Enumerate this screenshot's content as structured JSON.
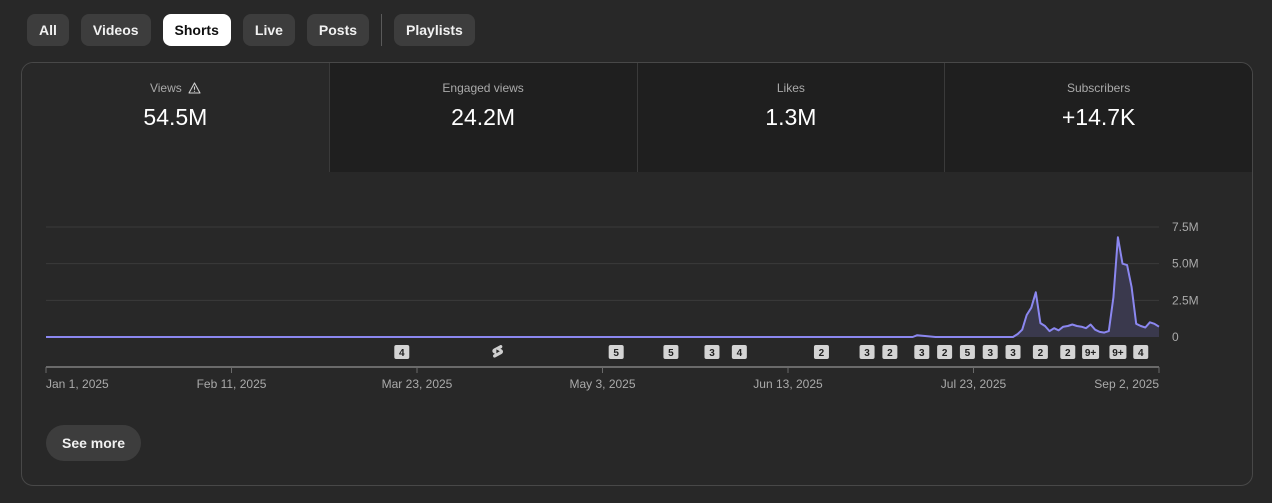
{
  "tabs": [
    {
      "label": "All",
      "active": false
    },
    {
      "label": "Videos",
      "active": false
    },
    {
      "label": "Shorts",
      "active": true
    },
    {
      "label": "Live",
      "active": false
    },
    {
      "label": "Posts",
      "active": false
    },
    {
      "label": "Playlists",
      "active": false
    }
  ],
  "metrics": [
    {
      "label": "Views",
      "value": "54.5M",
      "icon": "warning-icon",
      "active": true
    },
    {
      "label": "Engaged views",
      "value": "24.2M",
      "active": false
    },
    {
      "label": "Likes",
      "value": "1.3M",
      "active": false
    },
    {
      "label": "Subscribers",
      "value": "+14.7K",
      "active": false
    }
  ],
  "see_more_label": "See more",
  "colors": {
    "line": "#8b87f0",
    "fill": "#3a394d",
    "grid": "#3a3a3a",
    "text": "#aaaaaa"
  },
  "chart_data": {
    "type": "area",
    "x_tick_labels": [
      "Jan 1, 2025",
      "Feb 11, 2025",
      "Mar 23, 2025",
      "May 3, 2025",
      "Jun 13, 2025",
      "Jul 23, 2025",
      "Sep 2, 2025"
    ],
    "y_tick_labels": [
      "0",
      "2.5M",
      "5.0M",
      "7.5M"
    ],
    "ylim": [
      0,
      7500000
    ],
    "x_range_days": [
      0,
      244
    ],
    "series": [
      {
        "x": [
          0,
          190,
          191,
          195,
          202,
          212,
          213,
          214,
          215,
          216,
          217,
          218,
          219,
          220,
          221,
          222,
          223,
          224,
          225,
          226,
          227,
          228,
          229,
          230,
          231,
          232,
          233,
          234,
          235,
          236,
          237,
          238,
          239,
          240,
          241,
          242,
          243,
          244
        ],
        "values": [
          0,
          0,
          120000,
          0,
          0,
          0,
          200000,
          500000,
          1500000,
          2000000,
          3050000,
          950000,
          750000,
          400000,
          600000,
          450000,
          700000,
          750000,
          850000,
          750000,
          700000,
          600000,
          850000,
          500000,
          350000,
          300000,
          400000,
          2700000,
          6800000,
          5000000,
          4900000,
          3400000,
          900000,
          750000,
          650000,
          1000000,
          900000,
          700000
        ]
      }
    ],
    "upload_markers": [
      {
        "day": 78,
        "label": "4"
      },
      {
        "day": 99,
        "icon": "shorts-icon"
      },
      {
        "day": 125,
        "label": "5"
      },
      {
        "day": 137,
        "label": "5"
      },
      {
        "day": 146,
        "label": "3"
      },
      {
        "day": 152,
        "label": "4"
      },
      {
        "day": 170,
        "label": "2"
      },
      {
        "day": 180,
        "label": "3"
      },
      {
        "day": 185,
        "label": "2"
      },
      {
        "day": 192,
        "label": "3"
      },
      {
        "day": 197,
        "label": "2"
      },
      {
        "day": 202,
        "label": "5"
      },
      {
        "day": 207,
        "label": "3"
      },
      {
        "day": 212,
        "label": "3"
      },
      {
        "day": 218,
        "label": "2"
      },
      {
        "day": 224,
        "label": "2"
      },
      {
        "day": 229,
        "label": "9+"
      },
      {
        "day": 235,
        "label": "9+"
      },
      {
        "day": 240,
        "label": "4"
      }
    ]
  }
}
